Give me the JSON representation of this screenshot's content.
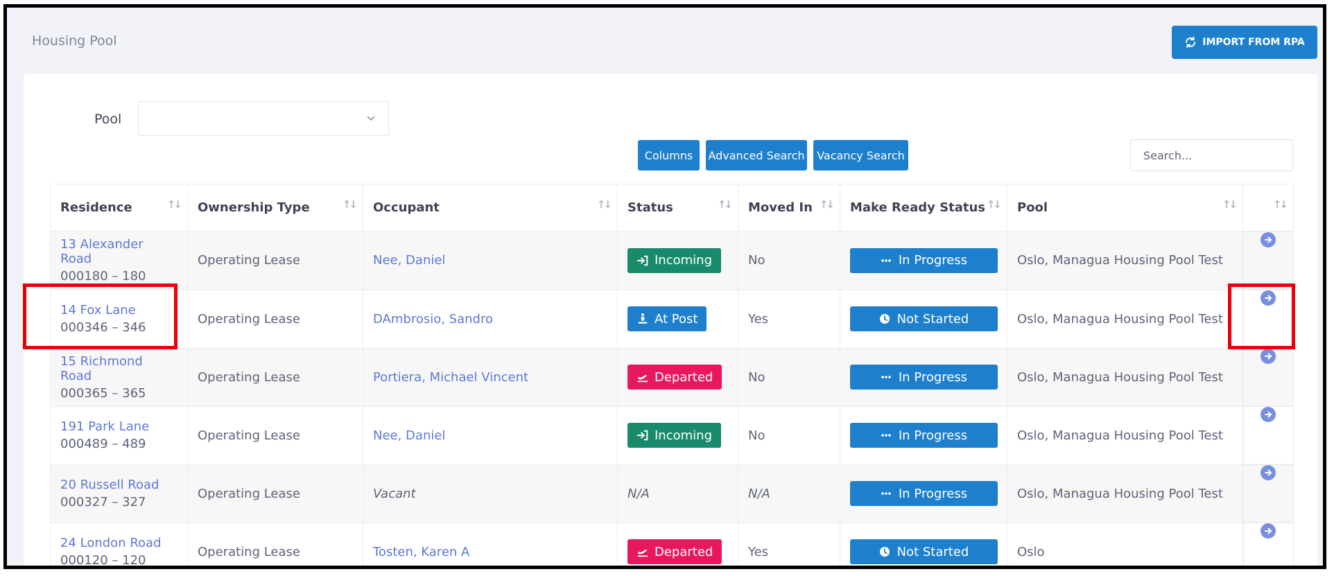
{
  "header": {
    "title": "Housing Pool",
    "import_label": "IMPORT FROM RPA"
  },
  "filter": {
    "pool_label": "Pool",
    "pool_value": ""
  },
  "toolbar": {
    "columns": "Columns",
    "advanced_search": "Advanced Search",
    "vacancy_search": "Vacancy Search",
    "search_placeholder": "Search..."
  },
  "table": {
    "columns": [
      "Residence",
      "Ownership Type",
      "Occupant",
      "Status",
      "Moved In",
      "Make Ready Status",
      "Pool",
      ""
    ],
    "rows": [
      {
        "residence": "13 Alexander Road",
        "code": "000180 – 180",
        "ownership": "Operating Lease",
        "occupant": "Nee, Daniel",
        "status": "Incoming",
        "moved_in": "No",
        "make_ready": "In Progress",
        "pool": "Oslo, Managua Housing Pool Test"
      },
      {
        "residence": "14 Fox Lane",
        "code": "000346 – 346",
        "ownership": "Operating Lease",
        "occupant": "DAmbrosio, Sandro",
        "status": "At Post",
        "moved_in": "Yes",
        "make_ready": "Not Started",
        "pool": "Oslo, Managua Housing Pool Test"
      },
      {
        "residence": "15 Richmond Road",
        "code": "000365 – 365",
        "ownership": "Operating Lease",
        "occupant": "Portiera, Michael Vincent",
        "status": "Departed",
        "moved_in": "No",
        "make_ready": "In Progress",
        "pool": "Oslo, Managua Housing Pool Test"
      },
      {
        "residence": "191 Park Lane",
        "code": "000489 – 489",
        "ownership": "Operating Lease",
        "occupant": "Nee, Daniel",
        "status": "Incoming",
        "moved_in": "No",
        "make_ready": "In Progress",
        "pool": "Oslo, Managua Housing Pool Test"
      },
      {
        "residence": "20 Russell Road",
        "code": "000327 – 327",
        "ownership": "Operating Lease",
        "occupant": "Vacant",
        "status": "N/A",
        "moved_in": "N/A",
        "make_ready": "In Progress",
        "pool": "Oslo, Managua Housing Pool Test"
      },
      {
        "residence": "24 London Road",
        "code": "000120 – 120",
        "ownership": "Operating Lease",
        "occupant": "Tosten, Karen A",
        "status": "Departed",
        "moved_in": "Yes",
        "make_ready": "Not Started",
        "pool": "Oslo"
      }
    ]
  },
  "colors": {
    "primary": "#1e80cc",
    "incoming": "#1a8a6c",
    "departed": "#e8185c",
    "link": "#5d78d6",
    "highlight": "#e8000b"
  }
}
